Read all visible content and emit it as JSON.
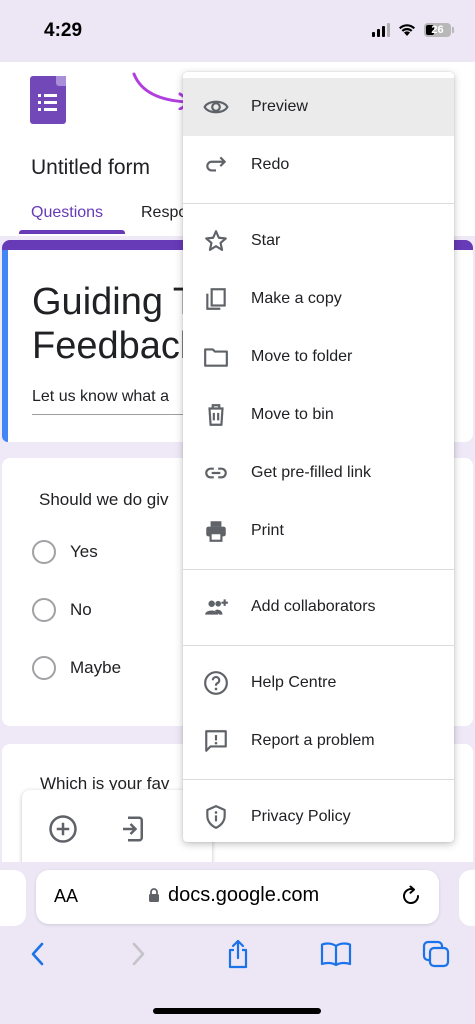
{
  "status_bar": {
    "time": "4:29",
    "battery": "26"
  },
  "form": {
    "name": "Untitled form",
    "tabs": [
      "Questions",
      "Respo"
    ],
    "title": "Guiding T\nFeedbacl",
    "description": "Let us know what a",
    "question1": {
      "text": "Should we do giv",
      "options": [
        "Yes",
        "No",
        "Maybe"
      ]
    },
    "question2": {
      "text": "Which is your fav"
    }
  },
  "menu": {
    "items": [
      {
        "label": "Preview",
        "icon": "eye-icon"
      },
      {
        "label": "Redo",
        "icon": "redo-icon"
      },
      {
        "label": "Star",
        "icon": "star-icon"
      },
      {
        "label": "Make a copy",
        "icon": "copy-icon"
      },
      {
        "label": "Move to folder",
        "icon": "folder-icon"
      },
      {
        "label": "Move to bin",
        "icon": "trash-icon"
      },
      {
        "label": "Get pre-filled link",
        "icon": "link-icon"
      },
      {
        "label": "Print",
        "icon": "print-icon"
      },
      {
        "label": "Add collaborators",
        "icon": "add-people-icon"
      },
      {
        "label": "Help Centre",
        "icon": "help-icon"
      },
      {
        "label": "Report a problem",
        "icon": "feedback-icon"
      },
      {
        "label": "Privacy Policy",
        "icon": "shield-icon"
      }
    ]
  },
  "browser": {
    "aa_label": "AA",
    "url": "docs.google.com"
  },
  "colors": {
    "forms_purple": "#673ab7",
    "annotation_arrow": "#b03ee0",
    "safari_blue": "#1a73e8"
  }
}
